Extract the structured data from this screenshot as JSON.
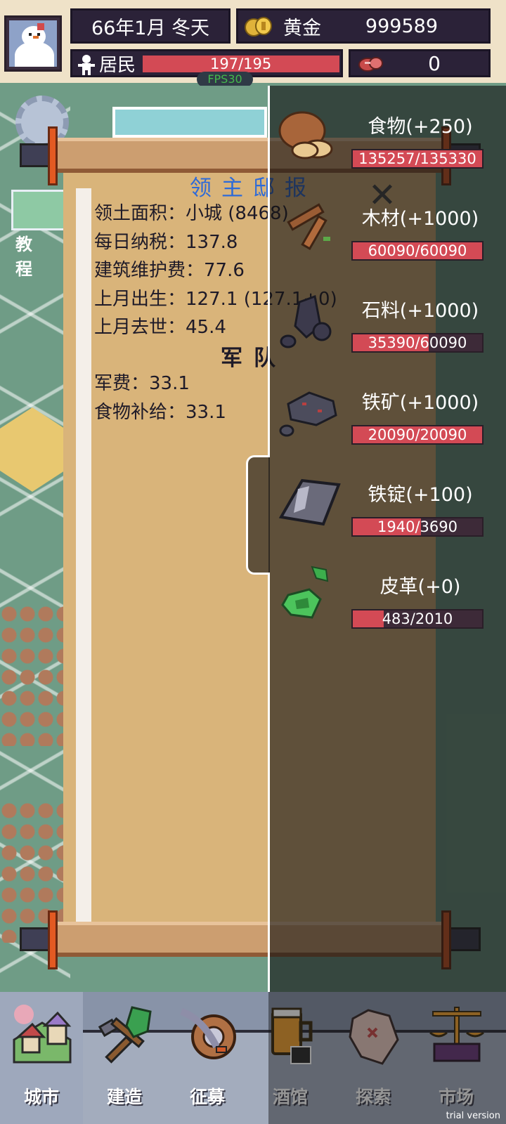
{
  "hud": {
    "date": "66年1月 冬天",
    "gold_label": "黄金",
    "gold_value": "999589",
    "population_label": "居民",
    "population_text": "197/195",
    "population_fill": 1.0,
    "meat_value": "0",
    "fps": "FPS30"
  },
  "tutorial_label": "教程",
  "report": {
    "title": "领主邸报",
    "lines": [
      "领土面积：小城 (8468)",
      "每日纳税：137.8",
      "建筑维护费：77.6",
      "上月出生：127.1 (127.1+0)",
      "上月去世：45.4"
    ],
    "army_title": "军队",
    "army_lines": [
      "军费：33.1",
      "食物补给：33.1"
    ]
  },
  "resources": [
    {
      "label": "食物(+250)",
      "text": "135257/135330",
      "fill": 0.9995,
      "icon": "bread-icon"
    },
    {
      "label": "木材(+1000)",
      "text": "60090/60090",
      "fill": 1.0,
      "icon": "wood-icon"
    },
    {
      "label": "石料(+1000)",
      "text": "35390/60090",
      "fill": 0.589,
      "icon": "stone-icon"
    },
    {
      "label": "铁矿(+1000)",
      "text": "20090/20090",
      "fill": 1.0,
      "icon": "iron-ore-icon"
    },
    {
      "label": "铁锭(+100)",
      "text": "1940/3690",
      "fill": 0.526,
      "icon": "iron-ingot-icon"
    },
    {
      "label": "皮革(+0)",
      "text": "483/2010",
      "fill": 0.24,
      "icon": "leather-icon"
    }
  ],
  "nav": [
    {
      "label": "城市",
      "icon": "city-icon",
      "active": true
    },
    {
      "label": "建造",
      "icon": "build-icon",
      "active": false
    },
    {
      "label": "征募",
      "icon": "recruit-icon",
      "active": false
    },
    {
      "label": "酒馆",
      "icon": "tavern-icon",
      "active": false
    },
    {
      "label": "探索",
      "icon": "explore-icon",
      "active": false
    },
    {
      "label": "市场",
      "icon": "market-icon",
      "active": false
    }
  ],
  "trial": "trial version",
  "colors": {
    "bar_fill": "#d34a55",
    "panel_bg": "#2b2238",
    "title_blue": "#2d6ad8"
  }
}
